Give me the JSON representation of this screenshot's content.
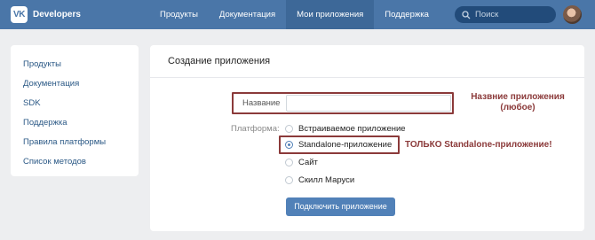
{
  "header": {
    "logo_badge": "VK",
    "logo_text": "Developers",
    "nav": [
      {
        "label": "Продукты"
      },
      {
        "label": "Документация"
      },
      {
        "label": "Мои приложения"
      },
      {
        "label": "Поддержка"
      }
    ],
    "active_nav": "Мои приложения",
    "search_placeholder": "Поиск",
    "accent_color": "#4a76a8"
  },
  "sidebar": {
    "items": [
      {
        "label": "Продукты"
      },
      {
        "label": "Документация"
      },
      {
        "label": "SDK"
      },
      {
        "label": "Поддержка"
      },
      {
        "label": "Правила платформы"
      },
      {
        "label": "Список методов"
      }
    ]
  },
  "form": {
    "title": "Создание приложения",
    "name_label": "Название",
    "name_value": "",
    "platform_label": "Платформа:",
    "platforms": [
      {
        "label": "Встраиваемое приложение",
        "checked": false
      },
      {
        "label": "Standalone-приложение",
        "checked": true
      },
      {
        "label": "Сайт",
        "checked": false
      },
      {
        "label": "Скилл Маруси",
        "checked": false
      }
    ],
    "submit_label": "Подключить приложение"
  },
  "annotations": {
    "name_note_line1": "Назвние приложения",
    "name_note_line2": "(любое)",
    "standalone_note": "ТОЛЬКО Standalone-приложение!",
    "color": "#8b3a3a"
  }
}
